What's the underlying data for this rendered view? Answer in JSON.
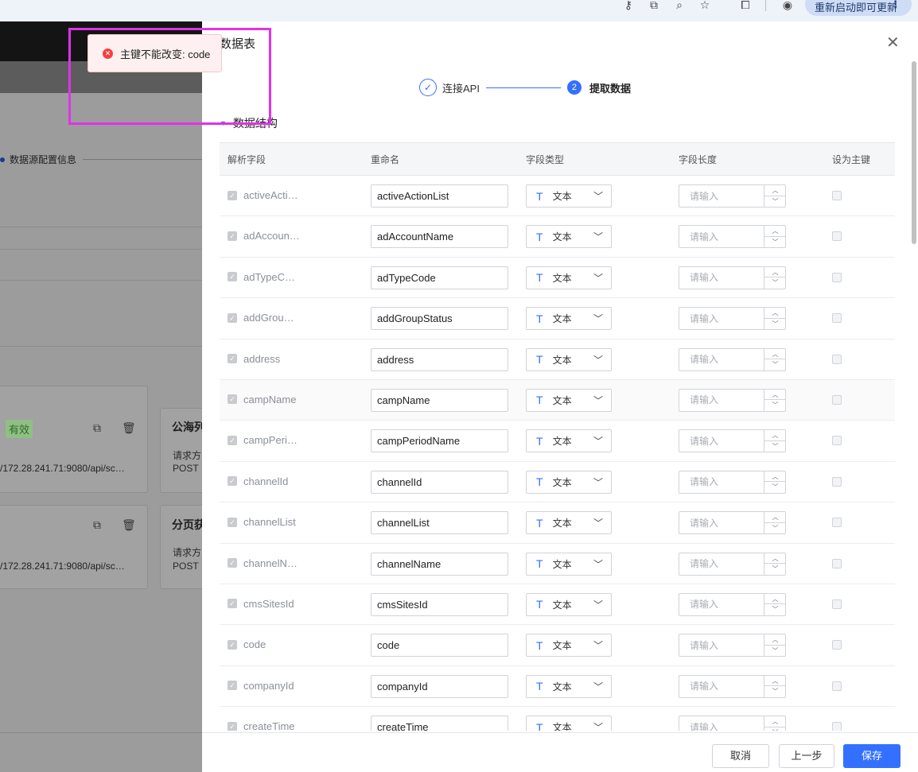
{
  "browser": {
    "update_label": "重新启动即可更新",
    "menu_icon": "more-vertical-icon"
  },
  "background": {
    "step_label": "数据源配置信息",
    "badge": "有效",
    "card1_url": "/172.28.241.71:9080/api/sc…",
    "card2_url": "/172.28.241.71:9080/api/sc…",
    "card3_title": "公海列",
    "card3_sub1": "请求方",
    "card3_sub2": "POST",
    "card4_title": "分页获",
    "card4_sub1": "请求方",
    "card4_sub2": "POST"
  },
  "drawer": {
    "title": "数据表",
    "steps": [
      {
        "label": "连接API",
        "state": "done"
      },
      {
        "label": "提取数据",
        "number": "2",
        "state": "active"
      }
    ],
    "section_title": "数据结构",
    "columns": [
      "解析字段",
      "重命名",
      "字段类型",
      "字段长度",
      "设为主键"
    ],
    "type_icon": "T",
    "type_label": "文本",
    "length_placeholder": "请输入",
    "rows": [
      {
        "field": "activeActi…",
        "rename": "activeActionList"
      },
      {
        "field": "adAccoun…",
        "rename": "adAccountName"
      },
      {
        "field": "adTypeC…",
        "rename": "adTypeCode"
      },
      {
        "field": "addGrou…",
        "rename": "addGroupStatus"
      },
      {
        "field": "address",
        "rename": "address"
      },
      {
        "field": "campName",
        "rename": "campName"
      },
      {
        "field": "campPeri…",
        "rename": "campPeriodName"
      },
      {
        "field": "channelId",
        "rename": "channelId"
      },
      {
        "field": "channelList",
        "rename": "channelList"
      },
      {
        "field": "channelN…",
        "rename": "channelName"
      },
      {
        "field": "cmsSitesId",
        "rename": "cmsSitesId"
      },
      {
        "field": "code",
        "rename": "code"
      },
      {
        "field": "companyId",
        "rename": "companyId"
      },
      {
        "field": "createTime",
        "rename": "createTime"
      }
    ],
    "footer": {
      "cancel": "取消",
      "prev": "上一步",
      "save": "保存"
    }
  },
  "toast": {
    "message": "主键不能改变: code",
    "type": "error",
    "color": "#f53f3f"
  },
  "colors": {
    "primary": "#3370ff",
    "highlight": "#e032e8"
  }
}
